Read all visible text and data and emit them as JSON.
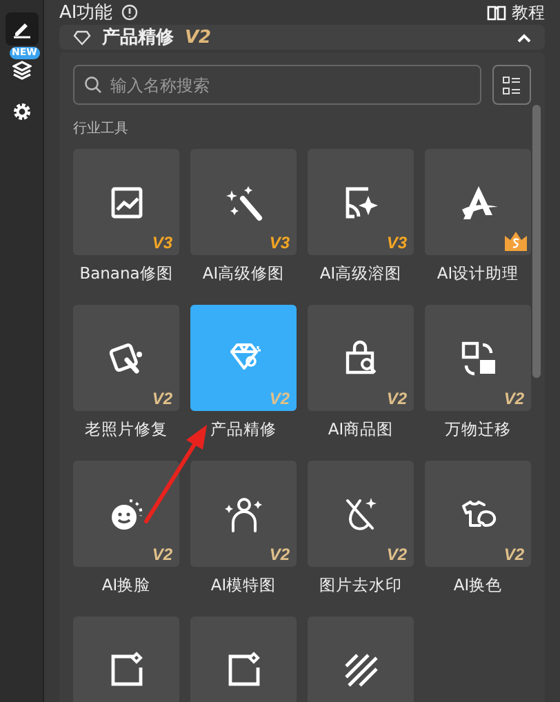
{
  "sidebar": {
    "items": [
      {
        "kind": "pen",
        "selected": true
      },
      {
        "kind": "layers",
        "selected": false,
        "badge": "NEW"
      },
      {
        "kind": "gear",
        "selected": false
      }
    ]
  },
  "header": {
    "title": "AI功能",
    "tutorial": "教程"
  },
  "dropdown": {
    "label": "产品精修",
    "version": "V2",
    "expanded": true
  },
  "search": {
    "placeholder": "输入名称搜索"
  },
  "section": "行业工具",
  "tools": [
    {
      "label": "Banana修图",
      "badge": "V3",
      "color": "#f5a623",
      "selected": false
    },
    {
      "label": "AI高级修图",
      "badge": "V3",
      "color": "#f5a623",
      "selected": false
    },
    {
      "label": "AI高级溶图",
      "badge": "V3",
      "color": "#f5a623",
      "selected": false
    },
    {
      "label": "AI设计助理",
      "premium": true,
      "selected": false
    },
    {
      "label": "老照片修复",
      "badge": "V2",
      "color": "#e0c08a",
      "selected": false
    },
    {
      "label": "产品精修",
      "badge": "V2",
      "color": "#e0c08a",
      "selected": true
    },
    {
      "label": "AI商品图",
      "badge": "V2",
      "color": "#e0c08a",
      "selected": false
    },
    {
      "label": "万物迁移",
      "badge": "V2",
      "color": "#e0c08a",
      "selected": false
    },
    {
      "label": "AI换脸",
      "badge": "V2",
      "color": "#e0c08a",
      "selected": false
    },
    {
      "label": "AI模特图",
      "badge": "V2",
      "color": "#e0c08a",
      "selected": false
    },
    {
      "label": "图片去水印",
      "badge": "V2",
      "color": "#e0c08a",
      "selected": false
    },
    {
      "label": "AI换色",
      "badge": "V2",
      "color": "#e0c08a",
      "selected": false
    },
    {
      "selected": false
    },
    {
      "selected": false
    },
    {
      "selected": false
    }
  ]
}
